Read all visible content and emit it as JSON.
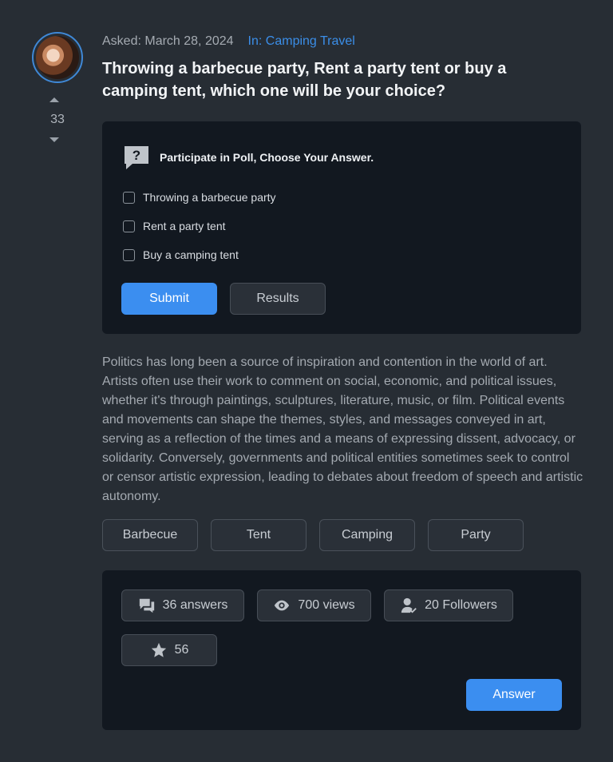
{
  "question": {
    "asked": "Asked: March 28, 2024",
    "category": "In: Camping Travel",
    "title": "Throwing a barbecue party, Rent a party tent or buy a camping tent, which one will be your choice?",
    "votes": "33",
    "body": "Politics has long been a source of inspiration and contention in the world of art. Artists often use their work to comment on social, economic, and political issues, whether it's through paintings, sculptures, literature, music, or film. Political events and movements can shape the themes, styles, and messages conveyed in art, serving as a reflection of the times and a means of expressing dissent, advocacy, or solidarity. Conversely, governments and political entities sometimes seek to control or censor artistic expression, leading to debates about freedom of speech and artistic autonomy."
  },
  "poll": {
    "heading": "Participate in Poll, Choose Your Answer.",
    "options": [
      "Throwing a barbecue party",
      "Rent a party tent",
      "Buy a camping tent"
    ],
    "submit_label": "Submit",
    "results_label": "Results"
  },
  "tags": [
    "Barbecue",
    "Tent",
    "Camping",
    "Party"
  ],
  "stats": {
    "answers": "36 answers",
    "views": "700 views",
    "followers": "20 Followers",
    "favorites": "56",
    "answer_label": "Answer"
  },
  "colors": {
    "accent": "#3b8ef0",
    "link": "#3b8ee8",
    "page_bg": "#272d34",
    "card_bg": "#121820"
  }
}
